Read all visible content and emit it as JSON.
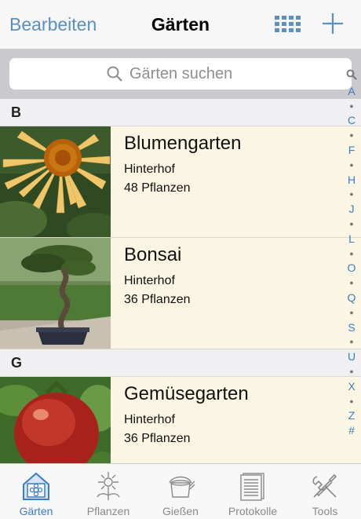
{
  "navbar": {
    "edit_label": "Bearbeiten",
    "title": "Gärten"
  },
  "search": {
    "placeholder": "Gärten suchen"
  },
  "sections": [
    {
      "header": "B",
      "items": [
        {
          "name": "Blumengarten",
          "location": "Hinterhof",
          "count": "48 Pflanzen",
          "image": "flower-photo"
        },
        {
          "name": "Bonsai",
          "location": "Hinterhof",
          "count": "36 Pflanzen",
          "image": "bonsai-photo"
        }
      ]
    },
    {
      "header": "G",
      "items": [
        {
          "name": "Gemüsegarten",
          "location": "Hinterhof",
          "count": "36 Pflanzen",
          "image": "tomato-photo"
        }
      ]
    }
  ],
  "index": [
    "A",
    "C",
    "F",
    "H",
    "J",
    "L",
    "O",
    "Q",
    "S",
    "U",
    "X",
    "Z",
    "#"
  ],
  "tabs": [
    {
      "label": "Gärten",
      "icon": "garden-icon",
      "active": true
    },
    {
      "label": "Pflanzen",
      "icon": "plant-icon",
      "active": false
    },
    {
      "label": "Gießen",
      "icon": "watering-can-icon",
      "active": false
    },
    {
      "label": "Protokolle",
      "icon": "log-icon",
      "active": false
    },
    {
      "label": "Tools",
      "icon": "tools-icon",
      "active": false
    }
  ],
  "colors": {
    "accent": "#3b7dc8",
    "nav_button": "#5b8fbf",
    "row_bg": "#fbf6e3",
    "section_bg": "#f0f0f2"
  }
}
